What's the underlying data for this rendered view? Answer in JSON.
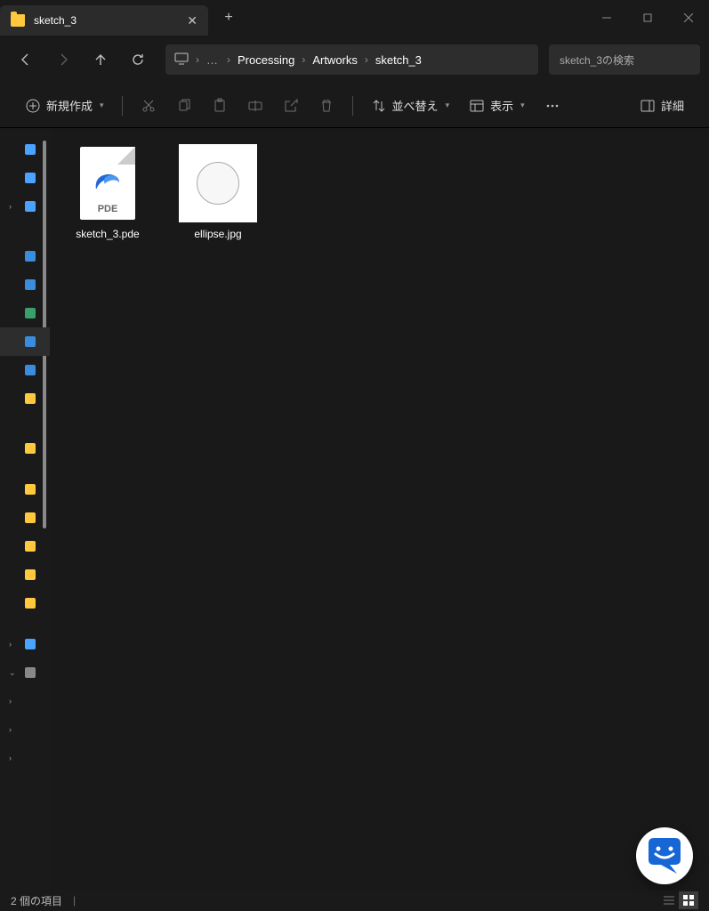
{
  "tab": {
    "title": "sketch_3"
  },
  "breadcrumb": {
    "items": [
      "Processing",
      "Artworks",
      "sketch_3"
    ]
  },
  "search": {
    "placeholder": "sketch_3の検索"
  },
  "toolbar": {
    "new_label": "新規作成",
    "sort_label": "並べ替え",
    "view_label": "表示",
    "details_label": "詳細"
  },
  "files": [
    {
      "name": "sketch_3.pde",
      "icon_label": "PDE"
    },
    {
      "name": "ellipse.jpg"
    }
  ],
  "status": {
    "count_label": "2 個の項目"
  }
}
